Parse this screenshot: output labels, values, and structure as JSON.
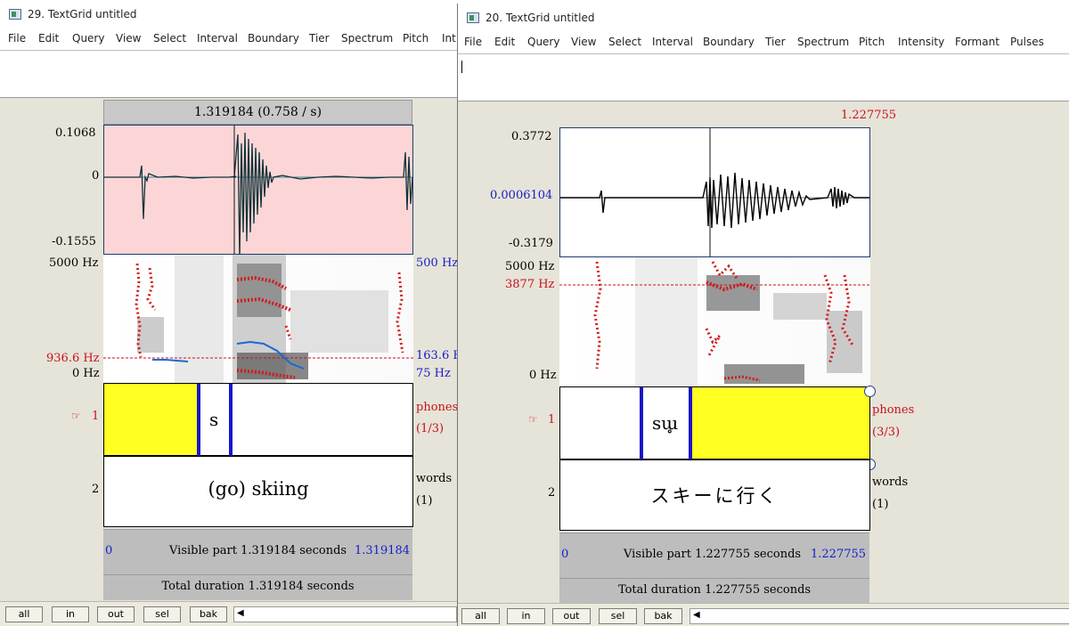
{
  "left_window": {
    "title": "29. TextGrid untitled",
    "menu": [
      "File",
      "Edit",
      "Query",
      "View",
      "Select",
      "Interval",
      "Boundary",
      "Tier",
      "Spectrum",
      "Pitch",
      "Int"
    ],
    "top_time": "1.319184 (0.758 / s)",
    "wave_max": "0.1068",
    "wave_zero": "0",
    "wave_min": "-0.1555",
    "spec_top": "5000 Hz",
    "spec_cursor": "936.6 Hz",
    "spec_bottom": "0 Hz",
    "pitch_top": "500 Hz",
    "pitch_cursor": "163.6 H",
    "pitch_bottom": "75 Hz",
    "tier1_num": "1",
    "tier1_hand": "☞",
    "tier1_text": "s",
    "tier1_name": "phones",
    "tier1_count": "(1/3)",
    "tier2_num": "2",
    "tier2_text": "(go) skiing",
    "tier2_name": "words",
    "tier2_count": "(1)",
    "vis_start": "0",
    "vis_text": "Visible part 1.319184 seconds",
    "vis_end": "1.319184",
    "total": "Total duration 1.319184 seconds",
    "buttons": [
      "all",
      "in",
      "out",
      "sel",
      "bak"
    ],
    "scroll_arrow": "◀"
  },
  "right_window": {
    "title": "20. TextGrid untitled",
    "menu": [
      "File",
      "Edit",
      "Query",
      "View",
      "Select",
      "Interval",
      "Boundary",
      "Tier",
      "Spectrum",
      "Pitch",
      "Intensity",
      "Formant",
      "Pulses"
    ],
    "top_time": "1.227755",
    "wave_max": "0.3772",
    "wave_cursor": "0.0006104",
    "wave_min": "-0.3179",
    "spec_top": "5000 Hz",
    "spec_cursor": "3877 Hz",
    "spec_bottom": "0 Hz",
    "tier1_num": "1",
    "tier1_hand": "☞",
    "tier1_text": "sɯ̥",
    "tier1_name": "phones",
    "tier1_count": "(3/3)",
    "tier2_num": "2",
    "tier2_text": "スキーに行く",
    "tier2_name": "words",
    "tier2_count": "(1)",
    "vis_start": "0",
    "vis_text": "Visible part 1.227755 seconds",
    "vis_end": "1.227755",
    "total": "Total duration 1.227755 seconds",
    "buttons": [
      "all",
      "in",
      "out",
      "sel",
      "bak"
    ],
    "scroll_arrow": "◀"
  },
  "colors": {
    "panel_bg": "#e6e3d8",
    "selection_pink": "#fcd6d6",
    "selection_yellow": "#ffff22",
    "boundary_blue": "#1a16c8",
    "label_red": "#c8121b",
    "label_blue": "#1620c8"
  },
  "icons": [
    "window-icon",
    "hand-pointer-icon",
    "boundary-circle-icon",
    "scroll-left-icon"
  ]
}
